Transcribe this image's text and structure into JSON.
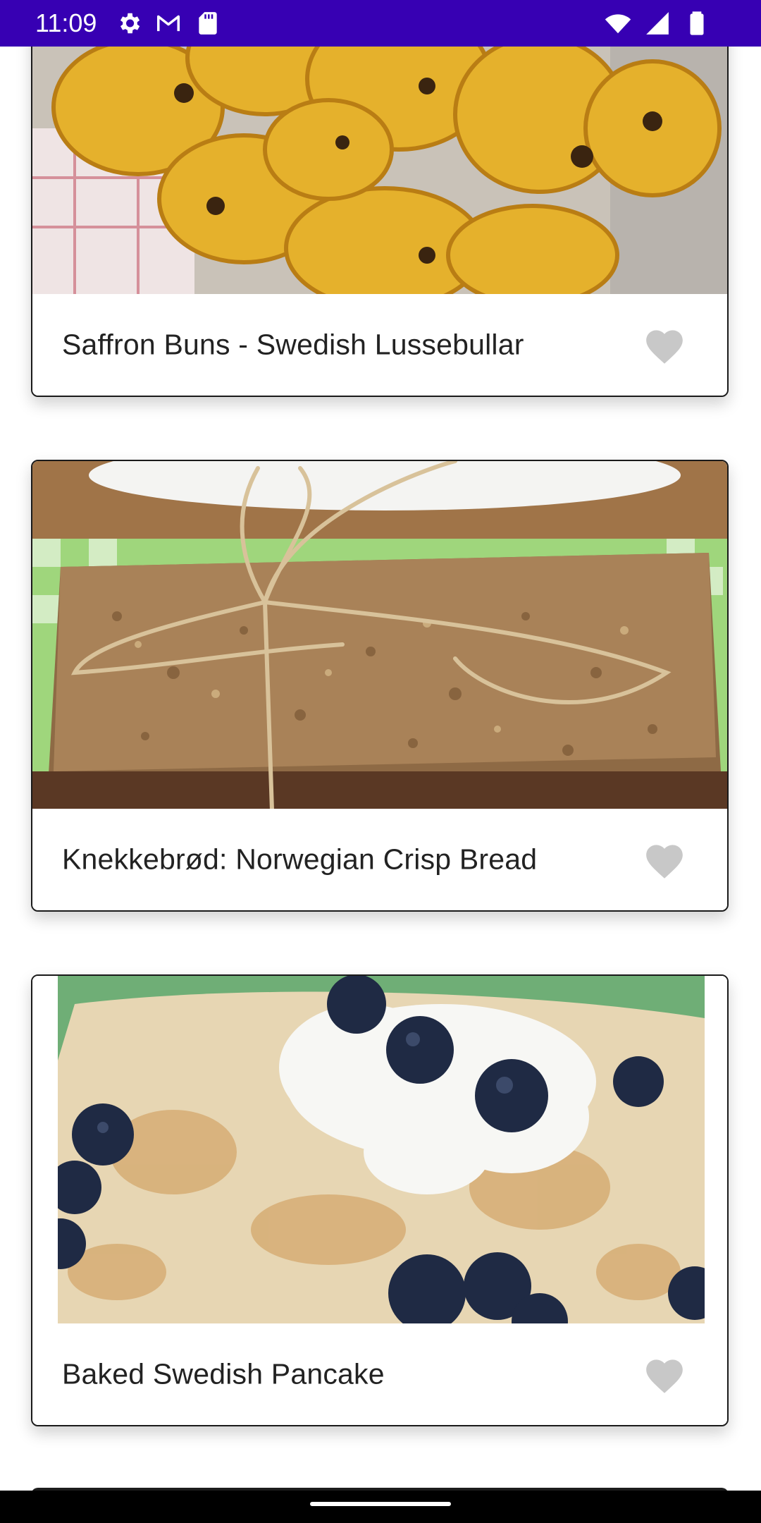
{
  "status_bar": {
    "time": "11:09",
    "background": "#3700b3",
    "left_icons": [
      "settings-icon",
      "gmail-icon",
      "sd-card-icon"
    ],
    "right_icons": [
      "wifi-icon",
      "cell-signal-icon",
      "battery-icon"
    ]
  },
  "recipes": [
    {
      "title": "Saffron Buns - Swedish Lussebullar",
      "image": "saffron-buns-photo",
      "favorite": false
    },
    {
      "title": "Knekkebrød: Norwegian Crisp Bread",
      "image": "crisp-bread-photo",
      "favorite": false
    },
    {
      "title": "Baked Swedish Pancake",
      "image": "swedish-pancake-photo",
      "favorite": false
    }
  ],
  "colors": {
    "heart_inactive": "#c8c8c8",
    "card_border": "#1a1a1a",
    "title_text": "#222222"
  }
}
